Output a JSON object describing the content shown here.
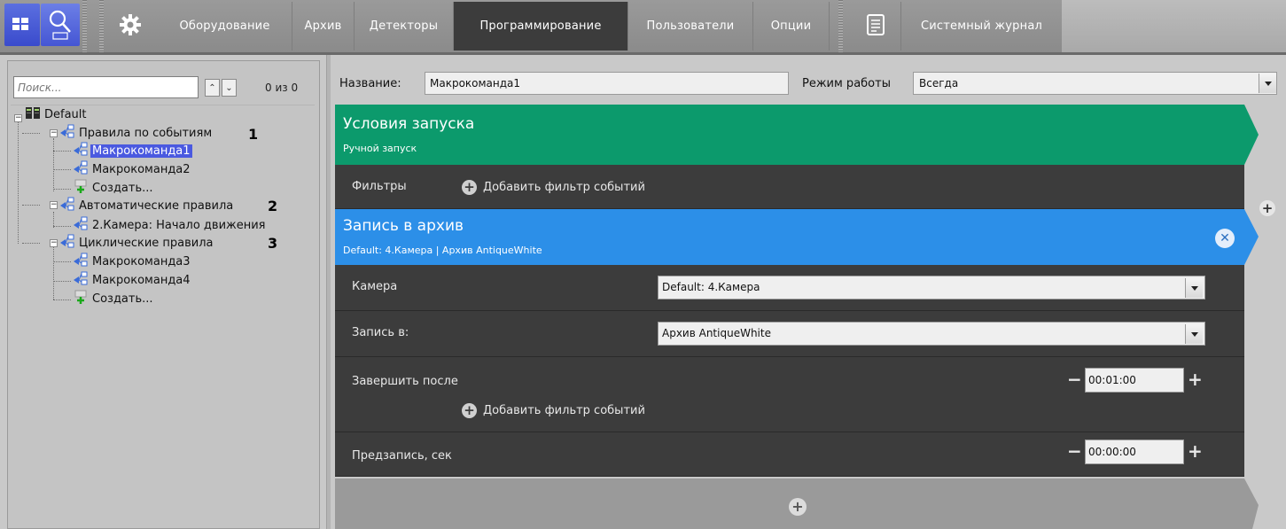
{
  "toolbar": {
    "tabs": [
      {
        "label": "Оборудование"
      },
      {
        "label": "Архив"
      },
      {
        "label": "Детекторы"
      },
      {
        "label": "Программирование",
        "active": true
      },
      {
        "label": "Пользователи"
      },
      {
        "label": "Опции"
      }
    ],
    "journal_label": "Системный журнал",
    "icons": [
      "layouts-icon",
      "search-archive-icon",
      "gear-icon",
      "journal-icon"
    ]
  },
  "left_panel": {
    "search_placeholder": "Поиск...",
    "match_count": "0 из 0",
    "tree": {
      "root": "Default",
      "groups": [
        {
          "label": "Правила по событиям",
          "callout": "1",
          "items": [
            "Макрокоманда1",
            "Макрокоманда2"
          ],
          "create": "Создать...",
          "selected": "Макрокоманда1"
        },
        {
          "label": "Автоматические правила",
          "callout": "2",
          "items": [
            "2.Камера: Начало движения"
          ]
        },
        {
          "label": "Циклические правила",
          "callout": "3",
          "items": [
            "Макрокоманда3",
            "Макрокоманда4"
          ],
          "create": "Создать..."
        }
      ]
    }
  },
  "editor": {
    "name_label": "Название:",
    "name_value": "Макрокоманда1",
    "mode_label": "Режим работы",
    "mode_value": "Всегда",
    "conditions": {
      "title": "Условия запуска",
      "subtitle": "Ручной запуск",
      "filters_label": "Фильтры",
      "add_filter": "Добавить фильтр событий"
    },
    "action": {
      "title": "Запись в архив",
      "subtitle": "Default: 4.Камера | Архив AntiqueWhite",
      "rows": {
        "camera_label": "Камера",
        "camera_value": "Default: 4.Камера",
        "record_to_label": "Запись в:",
        "record_to_value": "Архив AntiqueWhite",
        "finish_after_label": "Завершить после",
        "finish_after_value": "00:01:00",
        "add_filter": "Добавить фильтр событий",
        "prerecord_label": "Предзапись, сек",
        "prerecord_value": "00:00:00"
      }
    }
  },
  "colors": {
    "toolbar": "#8f8f8f",
    "active_tab": "#3c3c3c",
    "conditions_block": "#0c9a6c",
    "action_block": "#2c8fe8",
    "dark_row": "#3c3c3c",
    "tree_selection": "#4a59e0"
  }
}
